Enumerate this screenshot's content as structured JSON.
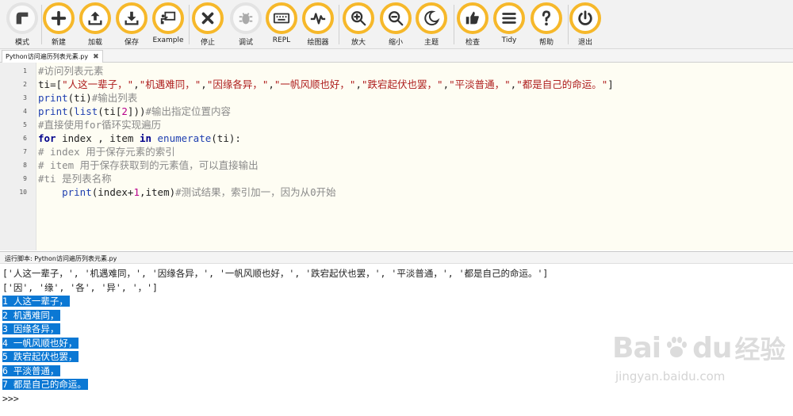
{
  "toolbar": {
    "accent_color": "#f6b82a",
    "buttons": [
      {
        "label": "模式",
        "icon": "mode-icon"
      },
      {
        "label": "新建",
        "icon": "plus-icon"
      },
      {
        "label": "加载",
        "icon": "upload-icon"
      },
      {
        "label": "保存",
        "icon": "download-icon"
      },
      {
        "label": "Example",
        "icon": "presentation-icon"
      },
      {
        "label": "停止",
        "icon": "close-icon"
      },
      {
        "label": "调试",
        "icon": "bug-icon"
      },
      {
        "label": "REPL",
        "icon": "keyboard-icon"
      },
      {
        "label": "绘图器",
        "icon": "pulse-icon"
      },
      {
        "label": "放大",
        "icon": "zoom-in-icon"
      },
      {
        "label": "缩小",
        "icon": "zoom-out-icon"
      },
      {
        "label": "主题",
        "icon": "moon-icon"
      },
      {
        "label": "检查",
        "icon": "thumbs-up-icon"
      },
      {
        "label": "Tidy",
        "icon": "menu-icon"
      },
      {
        "label": "帮助",
        "icon": "question-icon"
      },
      {
        "label": "退出",
        "icon": "power-icon"
      }
    ]
  },
  "tab": {
    "label": "Python访问遍历列表元素.py",
    "close": "✖"
  },
  "editor": {
    "line_numbers": [
      "1",
      "2",
      "3",
      "4",
      "5",
      "6",
      "7",
      "8",
      "9",
      "10"
    ],
    "lines": [
      [
        {
          "t": "#访问列表元素",
          "c": "c"
        }
      ],
      [
        {
          "t": "ti",
          "c": "p"
        },
        {
          "t": "=[",
          "c": "p"
        },
        {
          "t": "\"人这一辈子，\"",
          "c": "s"
        },
        {
          "t": ",",
          "c": "p"
        },
        {
          "t": "\"机遇难同，\"",
          "c": "s"
        },
        {
          "t": ",",
          "c": "p"
        },
        {
          "t": "\"因缘各异，\"",
          "c": "s"
        },
        {
          "t": ",",
          "c": "p"
        },
        {
          "t": "\"一帆风顺也好，\"",
          "c": "s"
        },
        {
          "t": ",",
          "c": "p"
        },
        {
          "t": "\"跌宕起伏也罢，\"",
          "c": "s"
        },
        {
          "t": ",",
          "c": "p"
        },
        {
          "t": "\"平淡普通，\"",
          "c": "s"
        },
        {
          "t": ",",
          "c": "p"
        },
        {
          "t": "\"都是自己的命运。\"",
          "c": "s"
        },
        {
          "t": "]",
          "c": "p"
        }
      ],
      [
        {
          "t": "print",
          "c": "f"
        },
        {
          "t": "(ti)",
          "c": "p"
        },
        {
          "t": "#输出列表",
          "c": "c"
        }
      ],
      [
        {
          "t": "print",
          "c": "f"
        },
        {
          "t": "(",
          "c": "p"
        },
        {
          "t": "list",
          "c": "f"
        },
        {
          "t": "(ti[",
          "c": "p"
        },
        {
          "t": "2",
          "c": "n"
        },
        {
          "t": "]))",
          "c": "p"
        },
        {
          "t": "#输出指定位置内容",
          "c": "c"
        }
      ],
      [
        {
          "t": "#直接使用for循环实现遍历",
          "c": "c"
        }
      ],
      [
        {
          "t": "for",
          "c": "k"
        },
        {
          "t": " index , item ",
          "c": "p"
        },
        {
          "t": "in",
          "c": "k"
        },
        {
          "t": " ",
          "c": "p"
        },
        {
          "t": "enumerate",
          "c": "f"
        },
        {
          "t": "(ti):",
          "c": "p"
        }
      ],
      [
        {
          "t": "# index 用于保存元素的索引",
          "c": "c"
        }
      ],
      [
        {
          "t": "# item 用于保存获取到的元素值，可以直接输出",
          "c": "c"
        }
      ],
      [
        {
          "t": "#ti 是列表名称",
          "c": "c"
        }
      ],
      [
        {
          "t": "    ",
          "c": "p"
        },
        {
          "t": "print",
          "c": "f"
        },
        {
          "t": "(index+",
          "c": "p"
        },
        {
          "t": "1",
          "c": "n"
        },
        {
          "t": ",item)",
          "c": "p"
        },
        {
          "t": "#测试结果，索引加一，因为从0开始",
          "c": "c"
        }
      ]
    ]
  },
  "output": {
    "title": "运行脚本: Python访问遍历列表元素.py",
    "lines": [
      {
        "text": "['人这一辈子，', '机遇难同，', '因缘各异，', '一帆风顺也好，', '跌宕起伏也罢，', '平淡普通，', '都是自己的命运。']",
        "selected": false
      },
      {
        "text": "['因', '缘', '各', '异', '，']",
        "selected": false
      },
      {
        "text": "1 人这一辈子，",
        "selected": true
      },
      {
        "text": "2 机遇难同，",
        "selected": true
      },
      {
        "text": "3 因缘各异，",
        "selected": true
      },
      {
        "text": "4 一帆风顺也好，",
        "selected": true
      },
      {
        "text": "5 跌宕起伏也罢，",
        "selected": true
      },
      {
        "text": "6 平淡普通，",
        "selected": true
      },
      {
        "text": "7 都是自己的命运。",
        "selected": true
      },
      {
        "text": ">>> ",
        "selected": false
      }
    ]
  },
  "watermark": {
    "brand_latin": "Bai",
    "brand_latin2": "du",
    "brand_cn": "经验",
    "url": "jingyan.baidu.com"
  }
}
